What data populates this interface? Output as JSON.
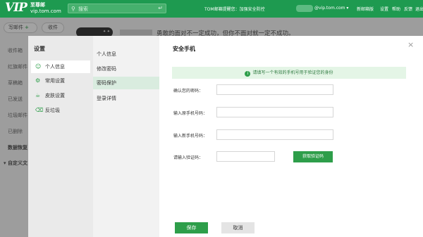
{
  "topbar": {
    "logo_mark": "VIP",
    "logo_cn": "至尊邮",
    "logo_url": "vip.tom.com",
    "search_placeholder": "搜索",
    "notice": "TOM邮箱提醒您：加强安全防控",
    "account": "@vip.tom.com ▾",
    "nav": [
      "新邮箱版",
      "设置",
      "帮助",
      "反馈",
      "退出"
    ]
  },
  "mail": {
    "compose_label": "写邮件",
    "compose_plus": "+",
    "receive_label": "收件",
    "folders": [
      "收件箱",
      "红旗邮件",
      "草稿箱",
      "已发送",
      "垃圾邮件",
      "已删除"
    ],
    "data_restore": "数据恢复",
    "custom_folder": "▾ 自定义文",
    "quote": "勇敢的面对不一定成功，但你不面对就一定不成功。"
  },
  "settings": {
    "title": "设置",
    "categories": [
      {
        "label": "个人信息",
        "icon": "person-icon"
      },
      {
        "label": "常用设置",
        "icon": "gear-icon"
      },
      {
        "label": "皮肤设置",
        "icon": "shirt-icon"
      },
      {
        "label": "反垃圾",
        "icon": "trash-icon"
      }
    ],
    "subitems": [
      "个人信息",
      "修改密码",
      "密码保护",
      "登录详情"
    ]
  },
  "panel": {
    "title": "安全手机",
    "info": "请填写一个有效的手机号用于验证您的身份",
    "fields": [
      {
        "label": "确认您的密码：",
        "value": ""
      },
      {
        "label": "输入原手机号码：",
        "value": ""
      },
      {
        "label": "输入新手机号码：",
        "value": ""
      },
      {
        "label": "请输入验证码：",
        "value": ""
      }
    ],
    "get_code": "获取验证码",
    "save": "保存",
    "cancel": "取消",
    "close": "×"
  },
  "colors": {
    "brand": "#1e9a50",
    "accent": "#2e9e4a",
    "info_bg": "#e4f5e6"
  }
}
